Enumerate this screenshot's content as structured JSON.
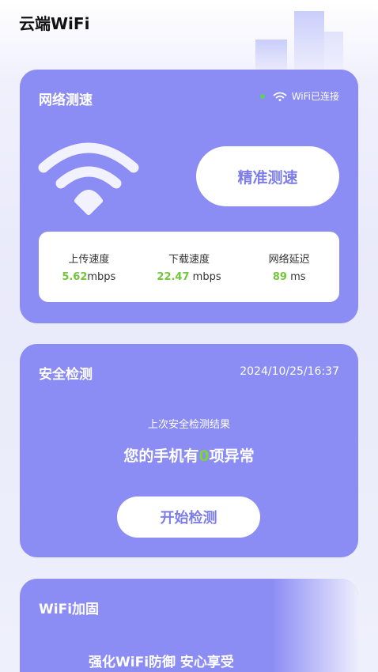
{
  "app": {
    "title": "云端WiFi"
  },
  "speed_card": {
    "title": "网络测速",
    "status": "WiFi已连接",
    "precise_button": "精准测速",
    "metrics": [
      {
        "label": "上传速度",
        "value": "5.62",
        "unit": "mbps"
      },
      {
        "label": "下载速度",
        "value": "22.47",
        "unit": " mbps"
      },
      {
        "label": "网络延迟",
        "value": "89",
        "unit": " ms"
      }
    ]
  },
  "security_card": {
    "title": "安全检测",
    "timestamp": "2024/10/25/16:37",
    "last_result_label": "上次安全检测结果",
    "abnormal_prefix": "您的手机有",
    "abnormal_count": "0",
    "abnormal_suffix": "项异常",
    "start_button": "开始检测"
  },
  "wifi_card": {
    "title": "WiFi加固",
    "slogan": "强化WiFi防御 安心享受"
  },
  "colors": {
    "card": "#8b8cf4",
    "accent_text": "#7c7dea",
    "highlight_green": "#72c63a",
    "status_dot": "#59d25a"
  }
}
